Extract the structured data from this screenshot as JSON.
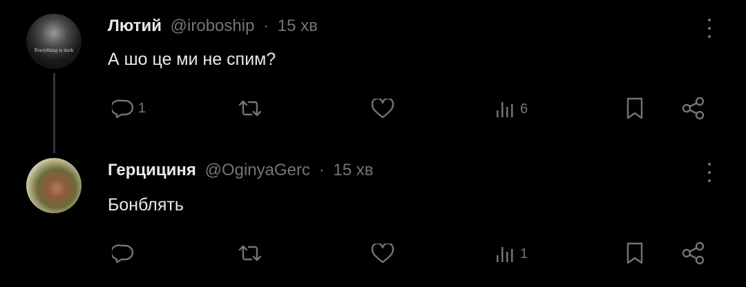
{
  "tweets": [
    {
      "name": "Лютий",
      "handle": "@iroboship",
      "separator": "·",
      "time": "15 хв",
      "text": "А шо це ми не спим?",
      "avatar_caption": "Everything is dark",
      "counts": {
        "reply": "1",
        "retweet": "",
        "like": "",
        "views": "6"
      }
    },
    {
      "name": "Герцициня",
      "handle": "@OginyaGerc",
      "separator": "·",
      "time": "15 хв",
      "text": "Бонблять",
      "counts": {
        "reply": "",
        "retweet": "",
        "like": "",
        "views": "1"
      }
    }
  ],
  "colors": {
    "background": "#000000",
    "text": "#e7e9ea",
    "muted": "#71767b",
    "thread_line": "#333639"
  },
  "icons": [
    "reply-icon",
    "retweet-icon",
    "like-icon",
    "views-icon",
    "bookmark-icon",
    "share-icon",
    "more-icon"
  ]
}
